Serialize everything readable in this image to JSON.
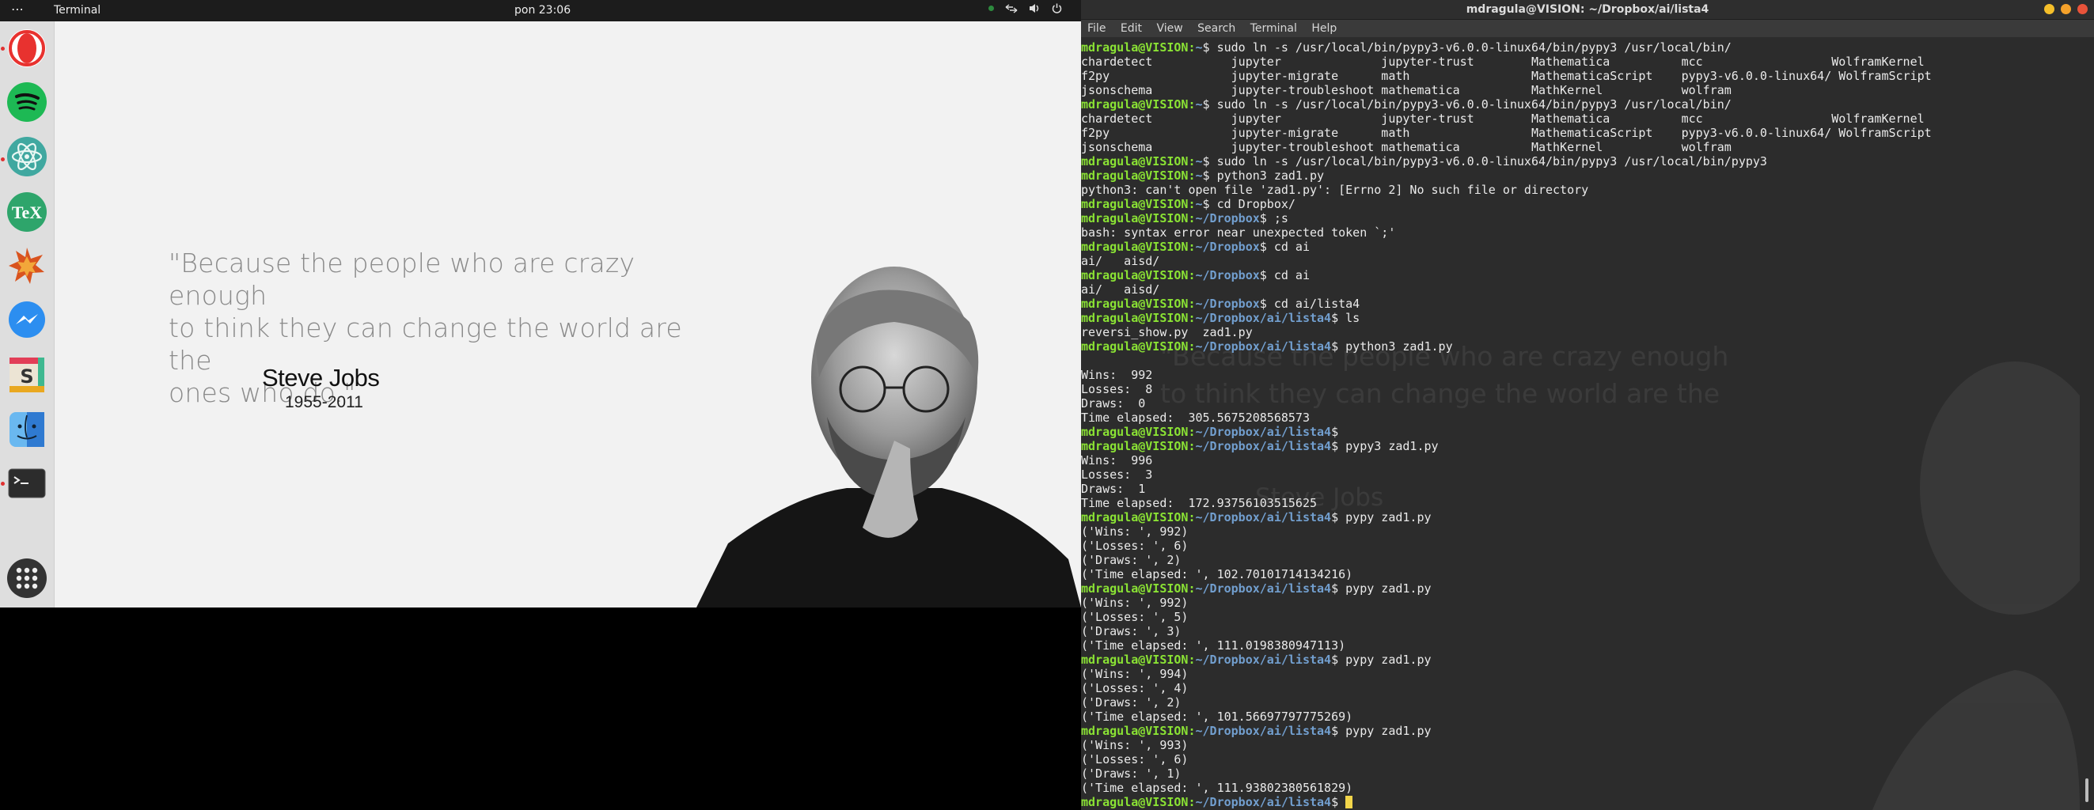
{
  "topbar": {
    "activities": "⋯",
    "app_name": "Terminal",
    "clock": "pon 23:06",
    "network_icon": "network-icon",
    "volume_icon": "volume-icon",
    "power_icon": "power-icon"
  },
  "dock": {
    "items": [
      {
        "name": "opera-icon",
        "color": "#e8322f"
      },
      {
        "name": "spotify-icon",
        "color": "#1db954"
      },
      {
        "name": "atom-icon",
        "color": "#56b6a0"
      },
      {
        "name": "texstudio-icon",
        "label": "TeX",
        "color": "#2ea56b"
      },
      {
        "name": "mathematica-icon",
        "color": "#d9531e"
      },
      {
        "name": "messenger-icon",
        "color": "#2c8ef0"
      },
      {
        "name": "slack-icon",
        "label": "S",
        "color": "#e9e1d2"
      },
      {
        "name": "finder-icon",
        "color": "#2f7ad1"
      },
      {
        "name": "terminal-icon",
        "color": "#2c2c2c"
      },
      {
        "name": "app-grid-icon",
        "color": "#333333"
      }
    ]
  },
  "wallpaper": {
    "quote_line1": "\"Because the people who are crazy enough",
    "quote_line2": "to think they can change the world are the",
    "quote_line3": "ones who do.\"",
    "author": "Steve Jobs",
    "years": "1955-2011"
  },
  "terminal": {
    "title": "mdragula@VISION: ~/Dropbox/ai/lista4",
    "menu": [
      "File",
      "Edit",
      "View",
      "Search",
      "Terminal",
      "Help"
    ],
    "user_host": "mdragula@VISION",
    "lines": [
      {
        "t": "p",
        "path": "~",
        "cmd": "sudo ln -s /usr/local/bin/pypy3-v6.0.0-linux64/bin/pypy3 /usr/local/bin/"
      },
      {
        "t": "o",
        "text": "chardetect           jupyter              jupyter-trust        Mathematica          mcc                  WolframKernel"
      },
      {
        "t": "o",
        "text": "f2py                 jupyter-migrate      math                 MathematicaScript    pypy3-v6.0.0-linux64/ WolframScript"
      },
      {
        "t": "o",
        "text": "jsonschema           jupyter-troubleshoot mathematica          MathKernel           wolfram"
      },
      {
        "t": "p",
        "path": "~",
        "cmd": "sudo ln -s /usr/local/bin/pypy3-v6.0.0-linux64/bin/pypy3 /usr/local/bin/"
      },
      {
        "t": "o",
        "text": "chardetect           jupyter              jupyter-trust        Mathematica          mcc                  WolframKernel"
      },
      {
        "t": "o",
        "text": "f2py                 jupyter-migrate      math                 MathematicaScript    pypy3-v6.0.0-linux64/ WolframScript"
      },
      {
        "t": "o",
        "text": "jsonschema           jupyter-troubleshoot mathematica          MathKernel           wolfram"
      },
      {
        "t": "p",
        "path": "~",
        "cmd": "sudo ln -s /usr/local/bin/pypy3-v6.0.0-linux64/bin/pypy3 /usr/local/bin/pypy3"
      },
      {
        "t": "p",
        "path": "~",
        "cmd": "python3 zad1.py"
      },
      {
        "t": "o",
        "text": "python3: can't open file 'zad1.py': [Errno 2] No such file or directory"
      },
      {
        "t": "p",
        "path": "~",
        "cmd": "cd Dropbox/"
      },
      {
        "t": "p",
        "path": "~/Dropbox",
        "cmd": ";s"
      },
      {
        "t": "o",
        "text": "bash: syntax error near unexpected token `;'"
      },
      {
        "t": "p",
        "path": "~/Dropbox",
        "cmd": "cd ai"
      },
      {
        "t": "o",
        "text": "ai/   aisd/"
      },
      {
        "t": "p",
        "path": "~/Dropbox",
        "cmd": "cd ai"
      },
      {
        "t": "o",
        "text": "ai/   aisd/"
      },
      {
        "t": "p",
        "path": "~/Dropbox",
        "cmd": "cd ai/lista4"
      },
      {
        "t": "p",
        "path": "~/Dropbox/ai/lista4",
        "cmd": "ls"
      },
      {
        "t": "o",
        "text": "reversi_show.py  zad1.py"
      },
      {
        "t": "p",
        "path": "~/Dropbox/ai/lista4",
        "cmd": "python3 zad1.py"
      },
      {
        "t": "o",
        "text": ""
      },
      {
        "t": "o",
        "text": "Wins:  992"
      },
      {
        "t": "o",
        "text": "Losses:  8"
      },
      {
        "t": "o",
        "text": "Draws:  0"
      },
      {
        "t": "o",
        "text": "Time elapsed:  305.5675208568573"
      },
      {
        "t": "p",
        "path": "~/Dropbox/ai/lista4",
        "cmd": ""
      },
      {
        "t": "p",
        "path": "~/Dropbox/ai/lista4",
        "cmd": "pypy3 zad1.py"
      },
      {
        "t": "o",
        "text": "Wins:  996"
      },
      {
        "t": "o",
        "text": "Losses:  3"
      },
      {
        "t": "o",
        "text": "Draws:  1"
      },
      {
        "t": "o",
        "text": "Time elapsed:  172.93756103515625"
      },
      {
        "t": "p",
        "path": "~/Dropbox/ai/lista4",
        "cmd": "pypy zad1.py"
      },
      {
        "t": "o",
        "text": "('Wins: ', 992)"
      },
      {
        "t": "o",
        "text": "('Losses: ', 6)"
      },
      {
        "t": "o",
        "text": "('Draws: ', 2)"
      },
      {
        "t": "o",
        "text": "('Time elapsed: ', 102.70101714134216)"
      },
      {
        "t": "p",
        "path": "~/Dropbox/ai/lista4",
        "cmd": "pypy zad1.py"
      },
      {
        "t": "o",
        "text": "('Wins: ', 992)"
      },
      {
        "t": "o",
        "text": "('Losses: ', 5)"
      },
      {
        "t": "o",
        "text": "('Draws: ', 3)"
      },
      {
        "t": "o",
        "text": "('Time elapsed: ', 111.0198380947113)"
      },
      {
        "t": "p",
        "path": "~/Dropbox/ai/lista4",
        "cmd": "pypy zad1.py"
      },
      {
        "t": "o",
        "text": "('Wins: ', 994)"
      },
      {
        "t": "o",
        "text": "('Losses: ', 4)"
      },
      {
        "t": "o",
        "text": "('Draws: ', 2)"
      },
      {
        "t": "o",
        "text": "('Time elapsed: ', 101.56697797775269)"
      },
      {
        "t": "p",
        "path": "~/Dropbox/ai/lista4",
        "cmd": "pypy zad1.py"
      },
      {
        "t": "o",
        "text": "('Wins: ', 993)"
      },
      {
        "t": "o",
        "text": "('Losses: ', 6)"
      },
      {
        "t": "o",
        "text": "('Draws: ', 1)"
      },
      {
        "t": "o",
        "text": "('Time elapsed: ', 111.93802380561829)"
      },
      {
        "t": "p",
        "path": "~/Dropbox/ai/lista4",
        "cmd": "",
        "cursor": true
      }
    ]
  },
  "colors": {
    "prompt_user": "#8ae234",
    "prompt_path": "#729fcf",
    "terminal_bg": "#2c2c2c",
    "cursor": "#f2d54a"
  }
}
